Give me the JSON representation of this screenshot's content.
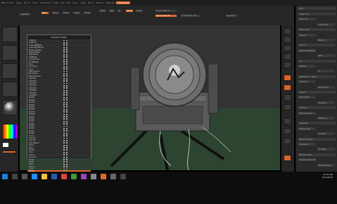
{
  "window": {
    "title": "ZBrush 4R7"
  },
  "topbar": {
    "items": [
      "ZBrush 4R7 P3",
      "Alpha",
      "Brush",
      "Color",
      "Document",
      "Draw",
      "Edit",
      "File",
      "Layer",
      "Light",
      "Macro",
      "Marker",
      "Material"
    ],
    "highlight": "QuickSave"
  },
  "toolbar": {
    "btn1": "Projection Master",
    "btn2": "LightBox",
    "btn3": "Edit",
    "btn4": "Draw",
    "btn5": "Move",
    "btn6": "Scale",
    "btn7": "Rotate",
    "mrgb": "Mrgb",
    "rgb": "Rgb",
    "m": "M",
    "zadd": "Zadd",
    "zsub": "Zsub",
    "focal": "Focal Shift 0",
    "draw": "Draw Size 64",
    "intensity": "Z Intensity 25",
    "dynamic": "Dynamic"
  },
  "subtool": {
    "title": "SubTool Master",
    "rows": [
      "Visibility",
      "TopBody",
      "LowerLeftBody",
      "LowerRightBody",
      "BolsteredWall",
      "BottomPlate",
      "RightPlate",
      "LeftPlate",
      "CageShield",
      "FrontBezel",
      "Ring",
      "LensRing",
      "Lens",
      "ZBrushLogo",
      "BackPlate",
      "RearHousing",
      "Cable01",
      "Cable02",
      "Cable03",
      "Cable04",
      "Cable05",
      "Cable06",
      "Cable07",
      "Cable08",
      "Bolt01",
      "Bolt02",
      "Bolt03",
      "Bolt04",
      "Bolt05",
      "Bolt06",
      "Bolt07",
      "Bolt08",
      "Nut01",
      "Nut02",
      "Nut03",
      "Nut04",
      "Nut05",
      "Nut06",
      "Nut07",
      "Nut08",
      "Hinge",
      "Bracket",
      "Handle",
      "HandleGrip",
      "Stand",
      "Base",
      "Wheel",
      "Axle",
      "Clamp",
      "Support",
      "Screw",
      "Panel",
      "Vent",
      "Switch",
      "Light",
      "Tripod"
    ],
    "selected_row": "Tripod"
  },
  "tray": {
    "title": "Tool",
    "rows": [
      "Load Tool",
      "Save As",
      "Copy Tool",
      "Paste Tool",
      "Import",
      "Export",
      "Clone",
      "Make PolyMesh3D",
      "GoZ",
      "All",
      "Visible",
      "R",
      "Lightbox > Tools",
      "SubTool",
      "Geometry",
      "Layers",
      "FiberMesh",
      "Preview",
      "Surface",
      "Deformation",
      "Masking",
      "Visibility",
      "Polygroups",
      "Contact",
      "Morph Target",
      "Polypaint",
      "UV Map",
      "Texture Map",
      "Displacement Map",
      "Normal Map"
    ]
  },
  "taskbar": {
    "time": "10:42 AM",
    "date": "3/14/2016"
  },
  "colors": {
    "accent": "#e06a2b",
    "bg": "#262626",
    "viewport_top": "#333333",
    "viewport_floor": "#2c4430"
  }
}
